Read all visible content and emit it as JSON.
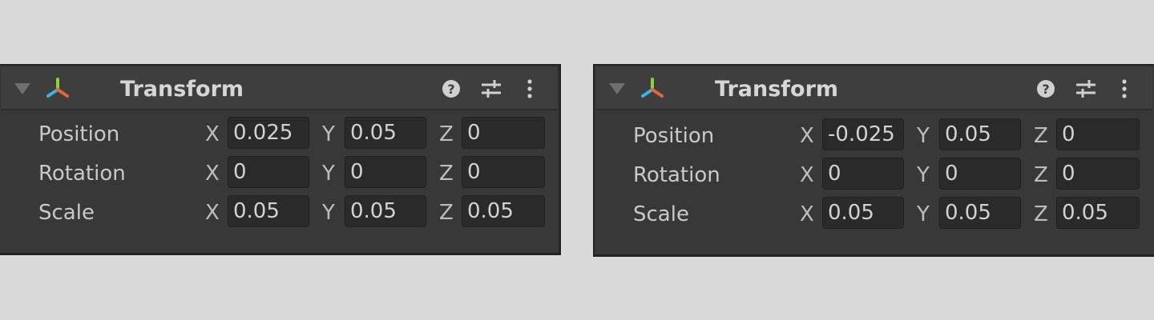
{
  "panels": [
    {
      "title": "Transform",
      "rows": [
        {
          "label": "Position",
          "x": "0.025",
          "y": "0.05",
          "z": "0"
        },
        {
          "label": "Rotation",
          "x": "0",
          "y": "0",
          "z": "0"
        },
        {
          "label": "Scale",
          "x": "0.05",
          "y": "0.05",
          "z": "0.05"
        }
      ]
    },
    {
      "title": "Transform",
      "rows": [
        {
          "label": "Position",
          "x": "-0.025",
          "y": "0.05",
          "z": "0"
        },
        {
          "label": "Rotation",
          "x": "0",
          "y": "0",
          "z": "0"
        },
        {
          "label": "Scale",
          "x": "0.05",
          "y": "0.05",
          "z": "0.05"
        }
      ]
    }
  ],
  "axes": {
    "x": "X",
    "y": "Y",
    "z": "Z"
  },
  "icons": {
    "component": "transform-axis-icon",
    "help": "help-icon",
    "presets": "presets-icon",
    "menu": "kebab-menu-icon"
  },
  "colors": {
    "background": "#d9d9d9",
    "panel": "#383838",
    "field": "#2a2a2a",
    "axis_x": "#e8643c",
    "axis_y": "#8ad23c",
    "axis_z": "#3c8ce8"
  }
}
